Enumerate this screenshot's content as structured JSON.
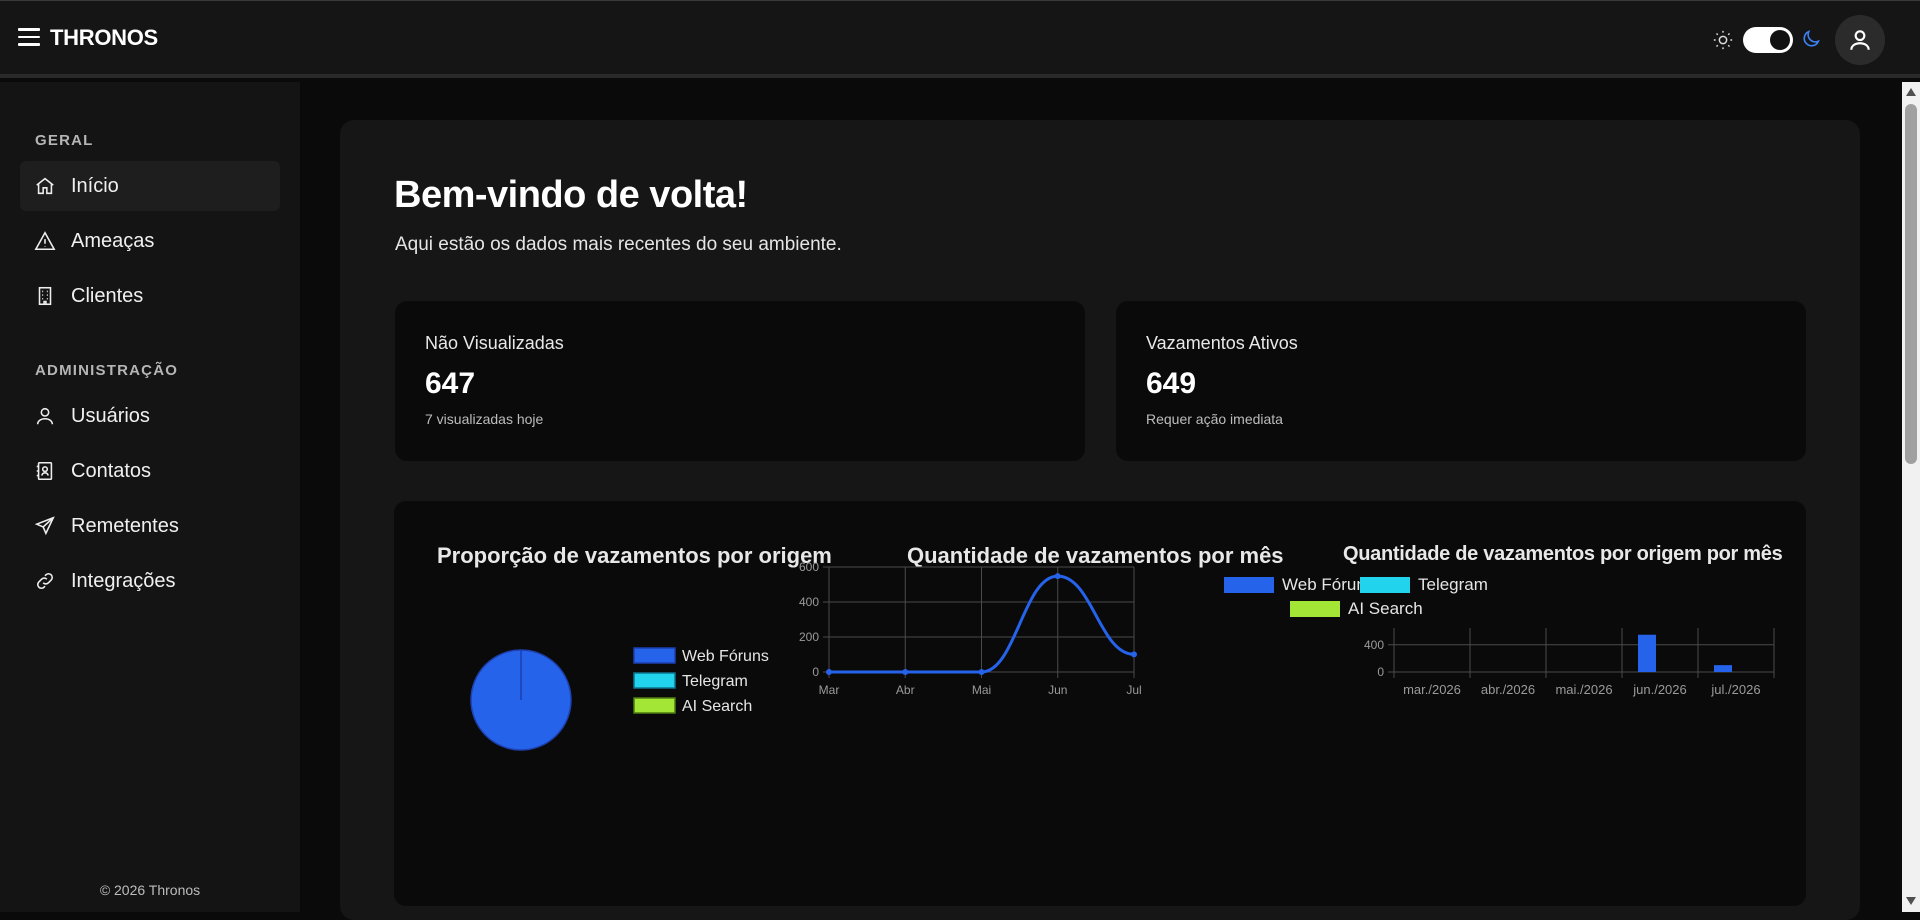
{
  "app": {
    "brand": "THRONOS"
  },
  "header": {
    "theme_mode": "dark"
  },
  "sidebar": {
    "sections": [
      {
        "title": "GERAL"
      },
      {
        "title": "ADMINISTRAÇÃO"
      }
    ],
    "items": [
      {
        "label": "Início",
        "icon": "home-icon",
        "active": true
      },
      {
        "label": "Ameaças",
        "icon": "warning-icon"
      },
      {
        "label": "Clientes",
        "icon": "building-icon"
      },
      {
        "label": "Usuários",
        "icon": "user-icon"
      },
      {
        "label": "Contatos",
        "icon": "contact-book-icon"
      },
      {
        "label": "Remetentes",
        "icon": "send-icon"
      },
      {
        "label": "Integrações",
        "icon": "link-icon"
      }
    ],
    "footer": "© 2026 Thronos"
  },
  "main": {
    "title": "Bem-vindo de volta!",
    "subtitle": "Aqui estão os dados mais recentes do seu ambiente.",
    "stats": [
      {
        "label": "Não Visualizadas",
        "value": "647",
        "note": "7 visualizadas hoje"
      },
      {
        "label": "Vazamentos Ativos",
        "value": "649",
        "note": "Requer ação imediata"
      }
    ]
  },
  "colors": {
    "web": "#2563eb",
    "telegram": "#22d3ee",
    "ai": "#a3e635"
  },
  "chart_data": [
    {
      "type": "pie",
      "title": "Proporção de vazamentos por origem",
      "labels": [
        "Web Fóruns",
        "Telegram",
        "AI Search"
      ],
      "values": [
        649,
        0,
        0
      ],
      "legend": "right"
    },
    {
      "type": "line",
      "title": "Quantidade de vazamentos por mês",
      "categories": [
        "Mar",
        "Abr",
        "Mai",
        "Jun",
        "Jul"
      ],
      "values": [
        0,
        0,
        0,
        548,
        101
      ],
      "ylim": [
        0,
        600
      ],
      "yticks": [
        "0",
        "200",
        "400",
        "600"
      ],
      "grid": true
    },
    {
      "type": "bar",
      "title": "Quantidade de vazamentos por origem por mês",
      "categories": [
        "mar./2026",
        "abr./2026",
        "mai./2026",
        "jun./2026",
        "jul./2026"
      ],
      "series": [
        {
          "name": "Web Fóruns",
          "values": [
            0,
            0,
            0,
            548,
            101
          ]
        },
        {
          "name": "Telegram",
          "values": [
            0,
            0,
            0,
            0,
            0
          ]
        },
        {
          "name": "AI Search",
          "values": [
            0,
            0,
            0,
            0,
            0
          ]
        }
      ],
      "ylim": [
        0,
        600
      ],
      "yticks": [
        "0",
        "400"
      ],
      "legend": "top",
      "grid": true
    }
  ]
}
